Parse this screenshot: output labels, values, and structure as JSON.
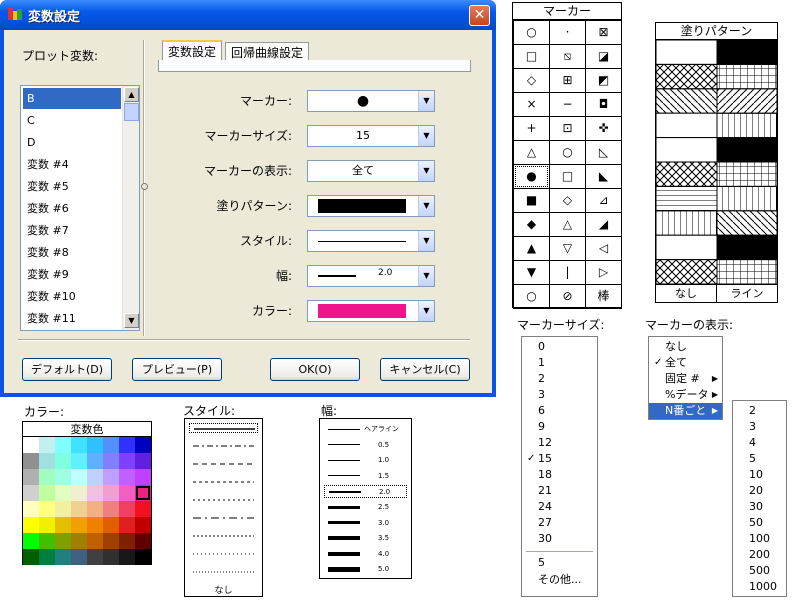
{
  "dialog": {
    "title": "変数設定",
    "close_label": "✕",
    "plot_var_label": "プロット変数:",
    "variables": [
      "B",
      "C",
      "D",
      "変数 #4",
      "変数 #5",
      "変数 #6",
      "変数 #7",
      "変数 #8",
      "変数 #9",
      "変数 #10",
      "変数 #11"
    ],
    "tabs": [
      "変数設定",
      "回帰曲線設定"
    ],
    "rows": [
      {
        "label": "マーカー:",
        "value": "●"
      },
      {
        "label": "マーカーサイズ:",
        "value": "15"
      },
      {
        "label": "マーカーの表示:",
        "value": "全て"
      },
      {
        "label": "塗りパターン:",
        "value": ""
      },
      {
        "label": "スタイル:",
        "value": ""
      },
      {
        "label": "幅:",
        "value": "2.0"
      },
      {
        "label": "カラー:",
        "value": ""
      }
    ],
    "buttons": {
      "default": "デフォルト(D)",
      "preview": "プレビュー(P)",
      "ok": "OK(O)",
      "cancel": "キャンセル(C)"
    },
    "fill_color": "#000000",
    "color_value": "#f0148c"
  },
  "marker_panel": {
    "title": "マーカー",
    "symbols": [
      [
        "○",
        "·",
        "⊠"
      ],
      [
        "□",
        "⧅",
        "◪"
      ],
      [
        "◇",
        "⊞",
        "◩"
      ],
      [
        "×",
        "−",
        "◘"
      ],
      [
        "+",
        "⊡",
        "✜"
      ],
      [
        "△",
        "○",
        "◺"
      ],
      [
        "●",
        "□",
        "◣"
      ],
      [
        "■",
        "◇",
        "⊿"
      ],
      [
        "◆",
        "△",
        "◢"
      ],
      [
        "▲",
        "▽",
        "◁"
      ],
      [
        "▼",
        "|",
        "▷"
      ],
      [
        "○",
        "⊘",
        "棒"
      ]
    ]
  },
  "pattern_panel": {
    "title": "塗りパターン",
    "none_label": "なし",
    "line_label": "ライン"
  },
  "marker_size": {
    "caption": "マーカーサイズ:",
    "items": [
      "0",
      "1",
      "2",
      "3",
      "6",
      "9",
      "12",
      "15",
      "18",
      "21",
      "24",
      "27",
      "30"
    ],
    "selected": "15",
    "extra": [
      "5",
      "その他..."
    ]
  },
  "marker_display": {
    "caption": "マーカーの表示:",
    "items": [
      "なし",
      "全て",
      "固定 #",
      "%データ",
      "N番ごと"
    ],
    "checked": "全て",
    "submenu": [
      "2",
      "3",
      "4",
      "5",
      "10",
      "20",
      "30",
      "50",
      "100",
      "200",
      "500",
      "1000"
    ]
  },
  "color_panel": {
    "caption": "カラー:",
    "header": "変数色"
  },
  "style_panel": {
    "caption": "スタイル:",
    "none_label": "なし"
  },
  "width_panel": {
    "caption": "幅:",
    "items": [
      "ヘアライン",
      "0.5",
      "1.0",
      "1.5",
      "2.0",
      "2.5",
      "3.0",
      "3.5",
      "4.0",
      "5.0"
    ]
  }
}
